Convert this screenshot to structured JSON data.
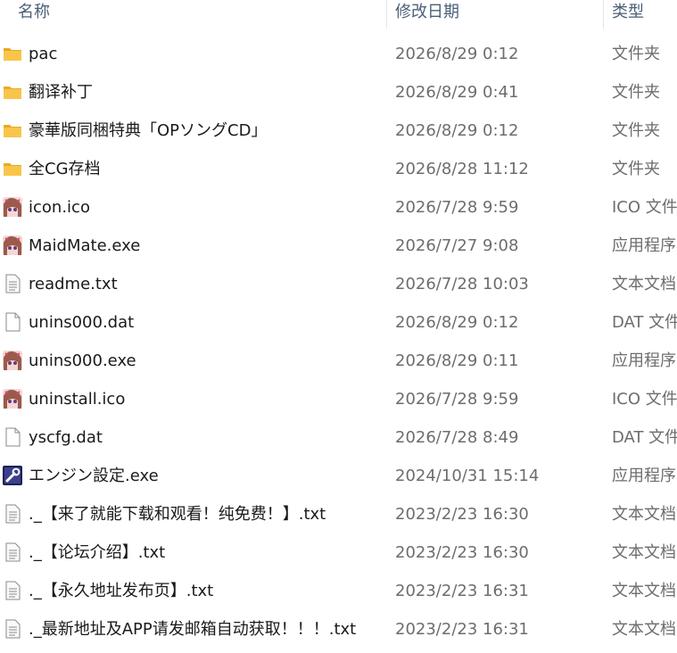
{
  "headers": {
    "name": "名称",
    "date": "修改日期",
    "type": "类型"
  },
  "files": [
    {
      "icon": "folder-icon",
      "name": "pac",
      "date": "2026/8/29 0:12",
      "type": "文件夹"
    },
    {
      "icon": "folder-icon",
      "name": "翻译补丁",
      "date": "2026/8/29 0:41",
      "type": "文件夹"
    },
    {
      "icon": "folder-icon",
      "name": "豪華版同梱特典「OPソングCD」",
      "date": "2026/8/29 0:12",
      "type": "文件夹"
    },
    {
      "icon": "folder-icon",
      "name": "全CG存档",
      "date": "2026/8/28 11:12",
      "type": "文件夹"
    },
    {
      "icon": "anime-app-icon",
      "name": "icon.ico",
      "date": "2026/7/28 9:59",
      "type": "ICO 文件"
    },
    {
      "icon": "anime-app-icon",
      "name": "MaidMate.exe",
      "date": "2026/7/27 9:08",
      "type": "应用程序"
    },
    {
      "icon": "text-file-icon",
      "name": "readme.txt",
      "date": "2026/7/28 10:03",
      "type": "文本文档"
    },
    {
      "icon": "blank-file-icon",
      "name": "unins000.dat",
      "date": "2026/8/29 0:12",
      "type": "DAT 文件"
    },
    {
      "icon": "anime-app-icon",
      "name": "unins000.exe",
      "date": "2026/8/29 0:11",
      "type": "应用程序"
    },
    {
      "icon": "anime-app-icon",
      "name": "uninstall.ico",
      "date": "2026/7/28 9:59",
      "type": "ICO 文件"
    },
    {
      "icon": "blank-file-icon",
      "name": "yscfg.dat",
      "date": "2026/7/28 8:49",
      "type": "DAT 文件"
    },
    {
      "icon": "settings-app-icon",
      "name": "エンジン設定.exe",
      "date": "2024/10/31 15:14",
      "type": "应用程序"
    },
    {
      "icon": "text-file-icon",
      "name": "._【来了就能下载和观看！纯免费！】.txt",
      "date": "2023/2/23 16:30",
      "type": "文本文档"
    },
    {
      "icon": "text-file-icon",
      "name": "._【论坛介绍】.txt",
      "date": "2023/2/23 16:30",
      "type": "文本文档"
    },
    {
      "icon": "text-file-icon",
      "name": "._【永久地址发布页】.txt",
      "date": "2023/2/23 16:31",
      "type": "文本文档"
    },
    {
      "icon": "text-file-icon",
      "name": "._最新地址及APP请发邮箱自动获取！！！.txt",
      "date": "2023/2/23 16:31",
      "type": "文本文档"
    }
  ],
  "colors": {
    "folder": "#f8c54a",
    "folder_dark": "#e9a825",
    "header_text": "#4c5f78",
    "meta_text": "#6d6d6d"
  }
}
